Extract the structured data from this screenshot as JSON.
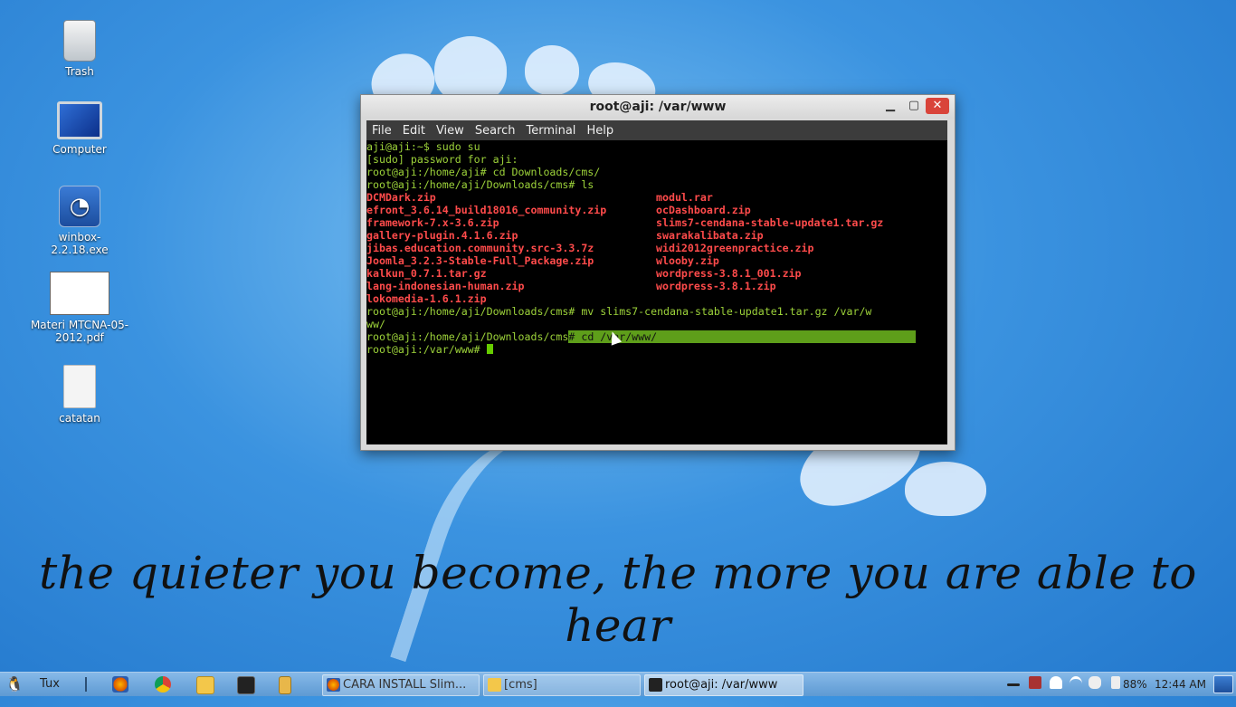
{
  "desktop": {
    "icons": [
      {
        "label": "Trash",
        "icon": "trash-icon"
      },
      {
        "label": "Computer",
        "icon": "computer-icon"
      },
      {
        "label": "winbox-2.2.18.exe",
        "icon": "winbox-icon"
      },
      {
        "label": "Materi MTCNA-05-2012.pdf",
        "icon": "pdf-thumbnail-icon"
      },
      {
        "label": "catatan",
        "icon": "text-file-icon"
      }
    ],
    "quote": "the quieter you become, the more you are able to hear"
  },
  "terminal": {
    "title": "root@aji: /var/www",
    "menu": [
      "File",
      "Edit",
      "View",
      "Search",
      "Terminal",
      "Help"
    ],
    "lines": [
      "aji@aji:~$ sudo su",
      "[sudo] password for aji:",
      "root@aji:/home/aji# cd Downloads/cms/",
      "root@aji:/home/aji/Downloads/cms# ls"
    ],
    "listing_left": [
      "DCMDark.zip",
      "efront_3.6.14_build18016_community.zip",
      "framework-7.x-3.6.zip",
      "gallery-plugin.4.1.6.zip",
      "jibas.education.community.src-3.3.7z",
      "Joomla_3.2.3-Stable-Full_Package.zip",
      "kalkun_0.7.1.tar.gz",
      "lang-indonesian-human.zip",
      "lokomedia-1.6.1.zip"
    ],
    "listing_right": [
      "modul.rar",
      "ocDashboard.zip",
      "slims7-cendana-stable-update1.tar.gz",
      "swarakalibata.zip",
      "widi2012greenpractice.zip",
      "wlooby.zip",
      "wordpress-3.8.1_001.zip",
      "wordpress-3.8.1.zip"
    ],
    "mv_line1": "root@aji:/home/aji/Downloads/cms# mv slims7-cendana-stable-update1.tar.gz /var/w",
    "mv_line2": "ww/",
    "cd_prompt": "root@aji:/home/aji/Downloads/cms",
    "cd_selected": "# cd /var/www/",
    "final_prompt": "root@aji:/var/www# "
  },
  "taskbar": {
    "start_label": "Tux",
    "launchers": [
      "firefox-icon",
      "chrome-icon",
      "file-manager-icon",
      "terminal-icon",
      "archive-icon"
    ],
    "tasks": [
      {
        "label": "CARA INSTALL Slim...",
        "icon": "firefox-icon"
      },
      {
        "label": "[cms]",
        "icon": "folder-icon"
      },
      {
        "label": "root@aji: /var/www",
        "icon": "terminal-icon"
      }
    ],
    "battery": "88%",
    "clock": "12:44 AM"
  },
  "colors": {
    "prompt_green": "#9dd33a",
    "file_red": "#ff4b4b",
    "selection_green": "#5e9e1a",
    "close_red": "#d9443a"
  }
}
